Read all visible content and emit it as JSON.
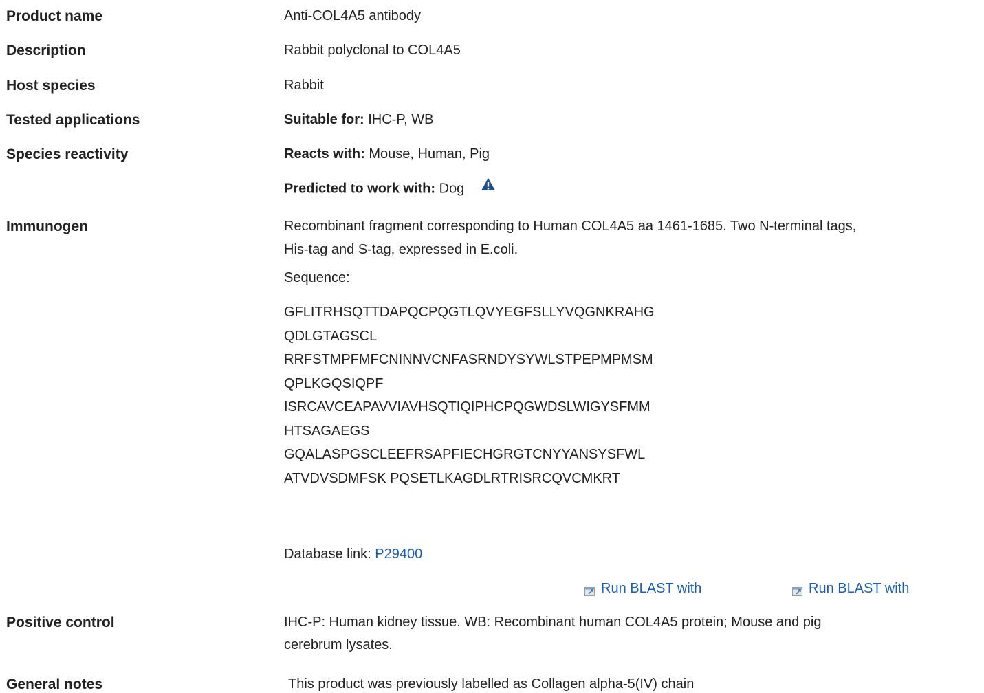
{
  "rows": {
    "product_name": {
      "label": "Product name",
      "value": "Anti-COL4A5 antibody"
    },
    "description": {
      "label": "Description",
      "value": "Rabbit polyclonal to COL4A5"
    },
    "host_species": {
      "label": "Host species",
      "value": "Rabbit"
    },
    "tested_applications": {
      "label": "Tested applications",
      "prefix": "Suitable for:",
      "value": " IHC-P, WB"
    },
    "species_reactivity": {
      "label": "Species reactivity",
      "reacts_prefix": "Reacts with:",
      "reacts_value": " Mouse, Human, Pig",
      "predicted_prefix": "Predicted to work with:",
      "predicted_value": " Dog"
    },
    "immunogen": {
      "label": "Immunogen",
      "line1": "Recombinant fragment corresponding to Human COL4A5 aa 1461-1685. Two N-terminal tags,",
      "line2": "His-tag and S-tag, expressed in E.coli.",
      "sequence_label": "Sequence:",
      "sequence_lines": [
        "GFLITRHSQTTDAPQCPQGTLQVYEGFSLLYVQGNKRAHG",
        "QDLGTAGSCL",
        "RRFSTMPFMFCNINNVCNFASRNDYSYWLSTPEPMPMSM",
        "QPLKGQSIQPF",
        "ISRCAVCEAPAVVIAVHSQTIQIPHCPQGWDSLWIGYSFMM",
        "HTSAGAEGS",
        "GQALASPGSCLEEFRSAPFIECHGRGTCNYYANSYSFWL",
        "ATVDVSDMFSK PQSETLKAGDLRTRISRCQVCMKRT"
      ],
      "database_prefix": "Database link: ",
      "database_link": "P29400",
      "blast_1": "Run BLAST with",
      "blast_2": "Run BLAST with"
    },
    "positive_control": {
      "label": "Positive control",
      "line1": "IHC-P: Human kidney tissue. WB: Recombinant human COL4A5 protein; Mouse and pig",
      "line2": "cerebrum lysates."
    },
    "general_notes": {
      "label": "General notes",
      "value": "This product was previously labelled as Collagen alpha-5(IV) chain"
    }
  },
  "colors": {
    "link": "#1a5fb4",
    "warning_icon": "#1f4e8c"
  },
  "icons": {
    "warning": "warning-triangle-icon",
    "external": "external-link-icon"
  }
}
